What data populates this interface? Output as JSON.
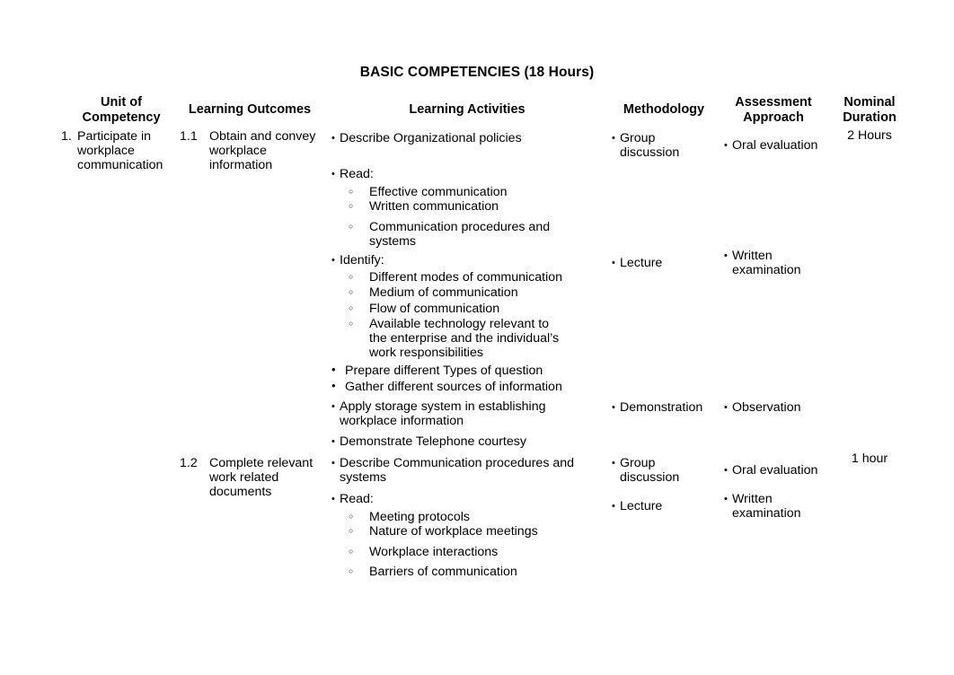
{
  "document": {
    "title": "BASIC COMPETENCIES (18 Hours)"
  },
  "table": {
    "headers": {
      "unit_of_competency": "Unit of\nCompetency",
      "unit_of_competency_line1": "Unit of",
      "unit_of_competency_line2": "Competency",
      "learning_outcomes": "Learning Outcomes",
      "learning_activities": "Learning Activities",
      "methodology": "Methodology",
      "assessment_line1": "Assessment",
      "assessment_line2": "Approach",
      "duration_line1": "Nominal",
      "duration_line2": "Duration"
    },
    "rows": [
      {
        "unit_number": "1.",
        "unit_text": "Participate in workplace communication",
        "outcome_number": "1.1",
        "outcome_text": "Obtain  and convey workplace information",
        "nominal_duration": "2 Hours",
        "learning_activities": [
          {
            "level": 1,
            "text": "Describe Organizational policies"
          },
          {
            "level": 1,
            "text": "Read:"
          },
          {
            "level": 2,
            "text": "Effective communication"
          },
          {
            "level": 2,
            "text": "Written communication"
          },
          {
            "level": 2,
            "text": "Communication procedures and systems"
          },
          {
            "level": 1,
            "text": "Identify:"
          },
          {
            "level": 2,
            "text": "Different modes of communication"
          },
          {
            "level": 2,
            "text": "Medium of communication"
          },
          {
            "level": 2,
            "text": "Flow of communication"
          },
          {
            "level": 2,
            "text": "Available technology relevant to the enterprise and the individual’s work responsibilities"
          },
          {
            "level": 1,
            "text": "Prepare different Types of question"
          },
          {
            "level": 1,
            "text": "Gather different sources of information"
          },
          {
            "level": 1,
            "text": "Apply storage system in establishing workplace information"
          },
          {
            "level": 1,
            "text": "Demonstrate Telephone courtesy"
          }
        ],
        "methodology": [
          {
            "text": "Group discussion"
          },
          {
            "text": "Lecture"
          },
          {
            "text": "Demonstration"
          }
        ],
        "assessment": [
          {
            "text": "Oral evaluation"
          },
          {
            "text": "Written examination"
          },
          {
            "text": "Observation"
          }
        ]
      },
      {
        "unit_number": "",
        "unit_text": "",
        "outcome_number": "1.2",
        "outcome_text": "Complete  relevant work related documents",
        "nominal_duration": "1 hour",
        "learning_activities": [
          {
            "level": 1,
            "text": "Describe Communication procedures and systems"
          },
          {
            "level": 1,
            "text": "Read:"
          },
          {
            "level": 2,
            "text": "Meeting protocols"
          },
          {
            "level": 2,
            "text": "Nature  of workplace meetings"
          },
          {
            "level": 2,
            "text": "Workplace interactions"
          },
          {
            "level": 2,
            "text": "Barriers of communication"
          }
        ],
        "methodology": [
          {
            "text": "Group discussion"
          },
          {
            "text": "Lecture"
          }
        ],
        "assessment": [
          {
            "text": "Oral evaluation"
          },
          {
            "text": "Written examination"
          }
        ]
      }
    ]
  },
  "bullets": {
    "level1_glyph": "filled-bullet",
    "level2_glyph": "hollow-circle"
  },
  "colors": {
    "text": "#000000",
    "background": "#ffffff"
  }
}
